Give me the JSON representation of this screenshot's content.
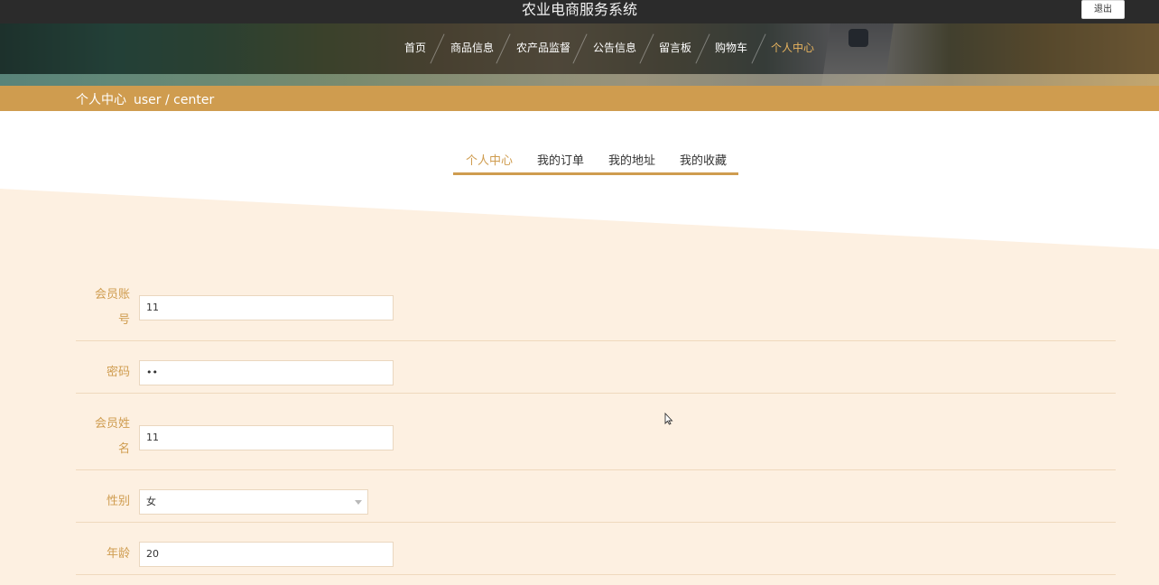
{
  "header": {
    "title": "农业电商服务系统",
    "logout_label": "退出"
  },
  "nav": {
    "items": [
      {
        "label": "首页"
      },
      {
        "label": "商品信息"
      },
      {
        "label": "农产品监督"
      },
      {
        "label": "公告信息"
      },
      {
        "label": "留言板"
      },
      {
        "label": "购物车"
      },
      {
        "label": "个人中心",
        "active": true
      }
    ]
  },
  "breadcrumb": {
    "title": "个人中心",
    "path": "user / center"
  },
  "tabs": [
    {
      "label": "个人中心",
      "active": true
    },
    {
      "label": "我的订单"
    },
    {
      "label": "我的地址"
    },
    {
      "label": "我的收藏"
    }
  ],
  "form": {
    "account": {
      "label_line1": "会员账",
      "label_line2": "号",
      "value": "11"
    },
    "password": {
      "label": "密码",
      "value": "••"
    },
    "name": {
      "label_line1": "会员姓",
      "label_line2": "名",
      "value": "11"
    },
    "gender": {
      "label": "性别",
      "value": "女"
    },
    "age": {
      "label": "年龄",
      "value": "20"
    }
  },
  "colors": {
    "accent": "#cf9c4f",
    "cream": "#fdf0e1",
    "topbar": "#2b2b2b"
  }
}
